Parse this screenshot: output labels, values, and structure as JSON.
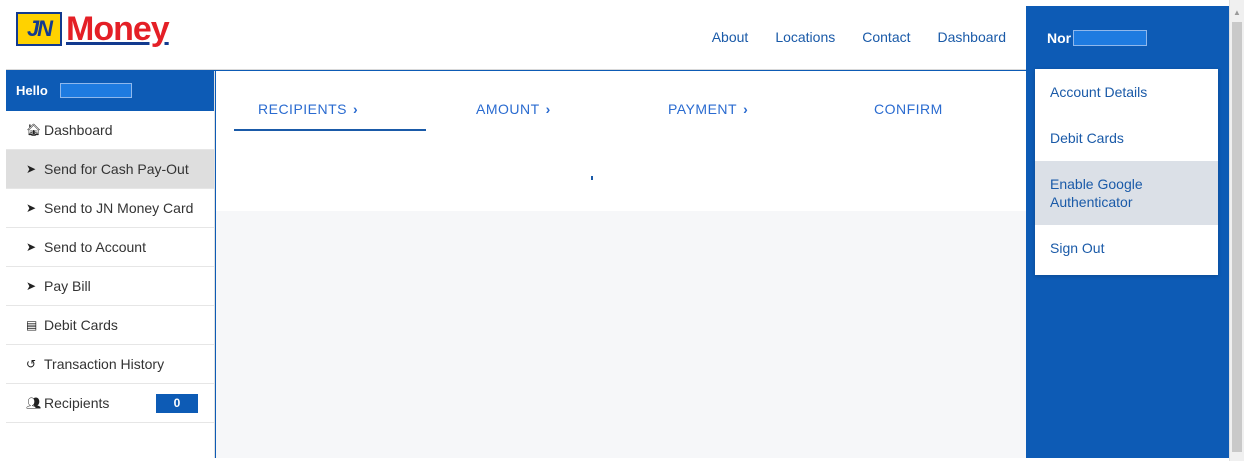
{
  "logo": {
    "badge": "JN",
    "text": "Money"
  },
  "topnav": [
    {
      "label": "About"
    },
    {
      "label": "Locations"
    },
    {
      "label": "Contact"
    },
    {
      "label": "Dashboard"
    }
  ],
  "user": {
    "name": "Nor"
  },
  "sidebar": {
    "hello": "Hello",
    "items": [
      {
        "label": "Dashboard",
        "icon": "home-icon",
        "glyph": "🏠︎"
      },
      {
        "label": "Send for Cash Pay-Out",
        "icon": "send-icon",
        "glyph": "➤"
      },
      {
        "label": "Send to JN Money Card",
        "icon": "send-icon",
        "glyph": "➤"
      },
      {
        "label": "Send to Account",
        "icon": "send-icon",
        "glyph": "➤"
      },
      {
        "label": "Pay Bill",
        "icon": "send-icon",
        "glyph": "➤"
      },
      {
        "label": "Debit Cards",
        "icon": "card-icon",
        "glyph": "▤"
      },
      {
        "label": "Transaction History",
        "icon": "history-icon",
        "glyph": "↺"
      },
      {
        "label": "Recipients",
        "icon": "people-icon",
        "glyph": "👥︎",
        "count": "0"
      }
    ]
  },
  "steps": [
    {
      "label": "RECIPIENTS",
      "chevron": "›"
    },
    {
      "label": "AMOUNT",
      "chevron": "›"
    },
    {
      "label": "PAYMENT",
      "chevron": "›"
    },
    {
      "label": "CONFIRM"
    }
  ],
  "dropdown": [
    {
      "label": "Account Details"
    },
    {
      "label": "Debit Cards"
    },
    {
      "label": "Enable Google Authenticator"
    },
    {
      "label": "Sign Out"
    }
  ],
  "colors": {
    "brand_blue": "#0d5bb5",
    "link_blue": "#1a5aa8",
    "logo_red": "#e41f26",
    "logo_yellow": "#ffd200"
  }
}
